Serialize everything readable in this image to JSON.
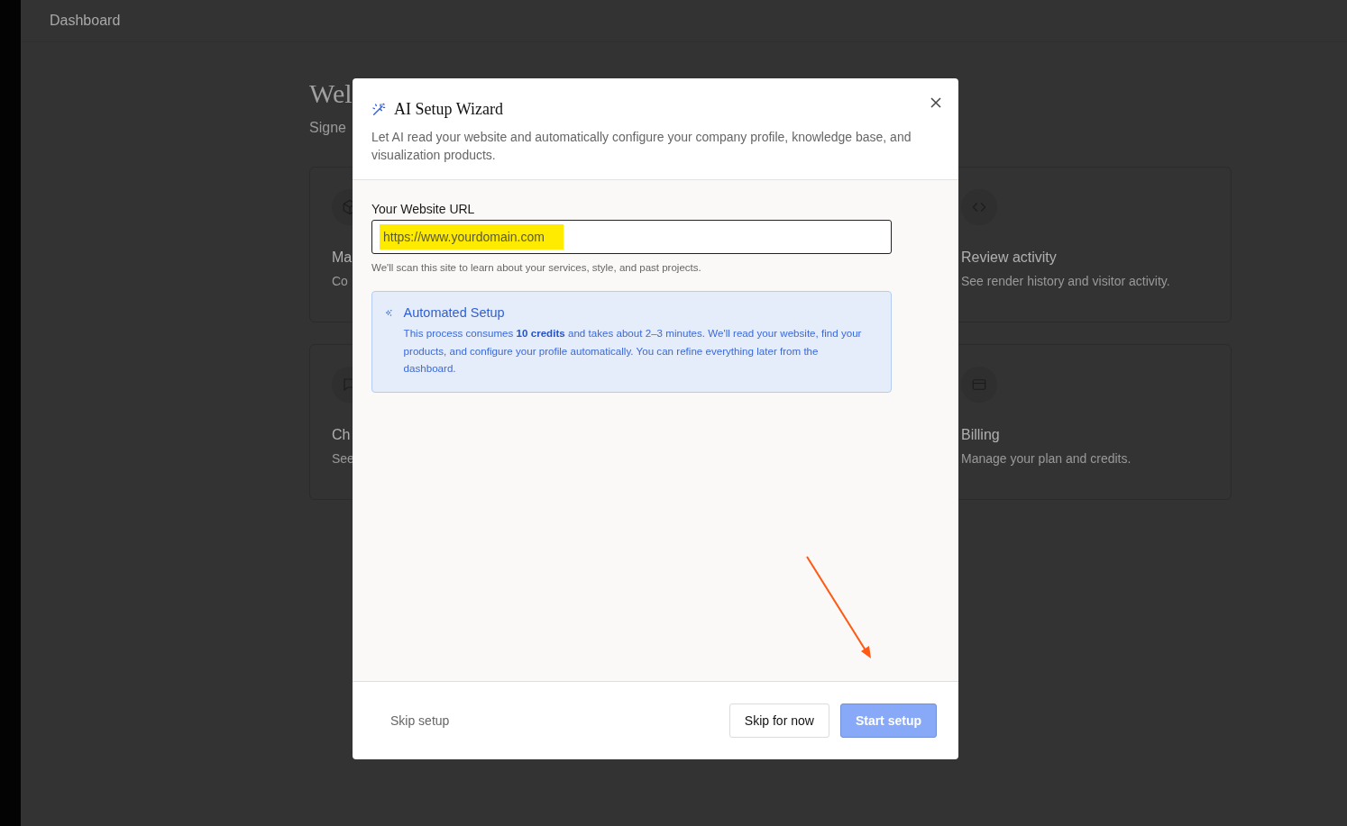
{
  "header": {
    "title": "Dashboard"
  },
  "welcome": {
    "title": "Wel",
    "subtitle": "Signe"
  },
  "card_rows": [
    {
      "left": {
        "title": "Ma",
        "description": "Co"
      },
      "right": {
        "title": "Review activity",
        "description": "See render history and visitor activity."
      }
    },
    {
      "left": {
        "title": "Ch",
        "description": "See"
      },
      "right": {
        "title": "Billing",
        "description": "Manage your plan and credits."
      }
    }
  ],
  "dialog": {
    "title": "AI Setup Wizard",
    "description": "Let AI read your website and automatically configure your company profile, knowledge base, and visualization products.",
    "url_field": {
      "label": "Your Website URL",
      "placeholder": "https://www.yourdomain.com",
      "hint": "We'll scan this site to learn about your services, style, and past projects."
    },
    "info": {
      "title": "Automated Setup",
      "text": "This process consumes **10 credits** and takes about 2–3 minutes. We'll read your website, find your products, and configure your profile automatically. You can refine everything later from the dashboard."
    },
    "footer": {
      "skip_link": "Skip setup",
      "buttons": [
        {
          "label": "Skip for now",
          "kind": "secondary",
          "disabled": false
        },
        {
          "label": "Start setup",
          "kind": "primary",
          "disabled": true
        }
      ]
    }
  }
}
